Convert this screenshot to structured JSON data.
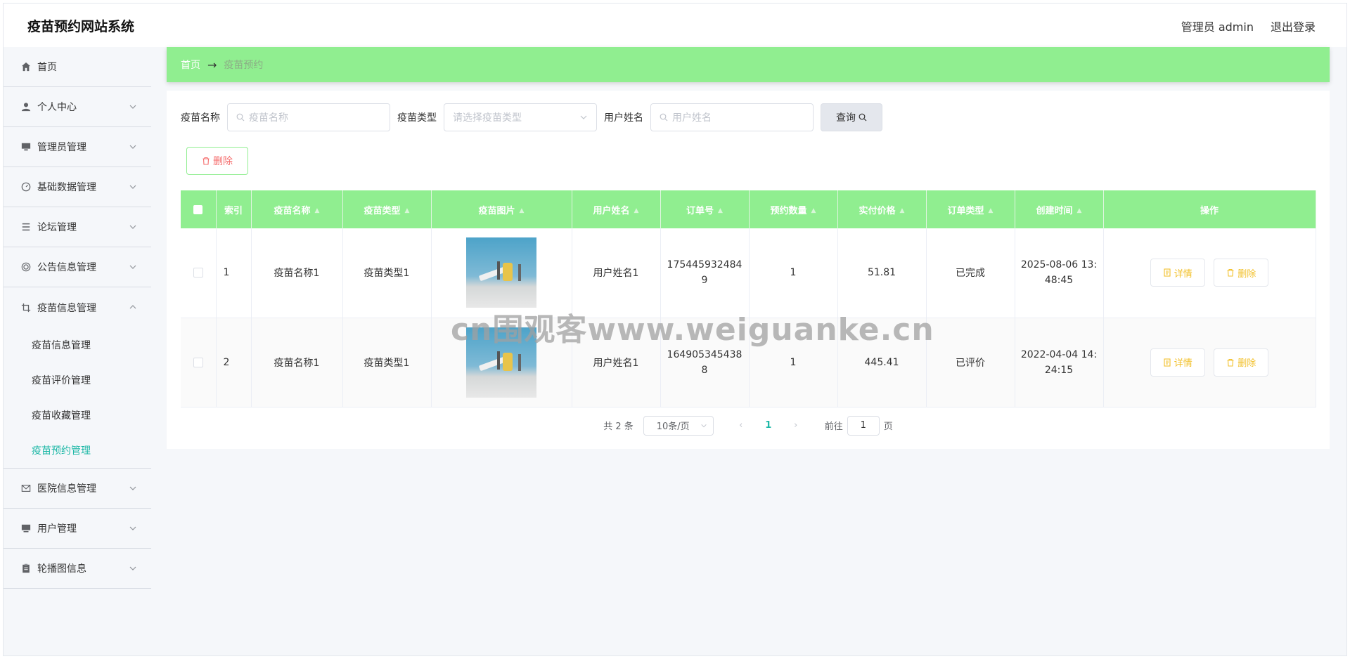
{
  "header": {
    "title": "疫苗预约网站系统",
    "user_label": "管理员 admin",
    "logout_label": "退出登录"
  },
  "sidebar": {
    "items": [
      {
        "label": "首页",
        "icon": "home-icon"
      },
      {
        "label": "个人中心",
        "icon": "user-icon"
      },
      {
        "label": "管理员管理",
        "icon": "admin-icon"
      },
      {
        "label": "基础数据管理",
        "icon": "gauge-icon"
      },
      {
        "label": "论坛管理",
        "icon": "list-icon"
      },
      {
        "label": "公告信息管理",
        "icon": "target-icon"
      },
      {
        "label": "疫苗信息管理",
        "icon": "crop-icon"
      }
    ],
    "submenu": [
      {
        "label": "疫苗信息管理"
      },
      {
        "label": "疫苗评价管理"
      },
      {
        "label": "疫苗收藏管理"
      },
      {
        "label": "疫苗预约管理"
      }
    ],
    "items_after": [
      {
        "label": "医院信息管理",
        "icon": "mail-icon"
      },
      {
        "label": "用户管理",
        "icon": "monitor-icon"
      },
      {
        "label": "轮播图信息",
        "icon": "clipboard-icon"
      }
    ]
  },
  "breadcrumb": {
    "home": "首页",
    "separator": "→",
    "current": "疫苗预约"
  },
  "search": {
    "vaccine_name_label": "疫苗名称",
    "vaccine_name_placeholder": "疫苗名称",
    "vaccine_type_label": "疫苗类型",
    "vaccine_type_placeholder": "请选择疫苗类型",
    "user_name_label": "用户姓名",
    "user_name_placeholder": "用户姓名",
    "query_label": "查询"
  },
  "toolbar": {
    "delete_label": "删除"
  },
  "table": {
    "headers": [
      "索引",
      "疫苗名称",
      "疫苗类型",
      "疫苗图片",
      "用户姓名",
      "订单号",
      "预约数量",
      "实付价格",
      "订单类型",
      "创建时间",
      "操作"
    ],
    "rows": [
      {
        "index": "1",
        "vaccine_name": "疫苗名称1",
        "vaccine_type": "疫苗类型1",
        "user_name": "用户姓名1",
        "order_no_line1": "175445932484",
        "order_no_line2": "9",
        "quantity": "1",
        "price": "51.81",
        "order_type": "已完成",
        "created_line1": "2025-08-06 13:",
        "created_line2": "48:45",
        "detail_label": "详情",
        "delete_label": "删除"
      },
      {
        "index": "2",
        "vaccine_name": "疫苗名称1",
        "vaccine_type": "疫苗类型1",
        "user_name": "用户姓名1",
        "order_no_line1": "164905345438",
        "order_no_line2": "8",
        "quantity": "1",
        "price": "445.41",
        "order_type": "已评价",
        "created_line1": "2022-04-04 14:",
        "created_line2": "24:15",
        "detail_label": "详情",
        "delete_label": "删除"
      }
    ]
  },
  "pagination": {
    "total_label": "共 2 条",
    "page_size": "10条/页",
    "current_page": "1",
    "goto_label": "前往",
    "goto_value": "1",
    "page_suffix": "页"
  },
  "watermark": "cn围观客www.weiguanke.cn",
  "colors": {
    "accent": "#90ee90",
    "active_menu": "#1fb8a7",
    "danger": "#f56c6c",
    "warning": "#f2c02a"
  }
}
